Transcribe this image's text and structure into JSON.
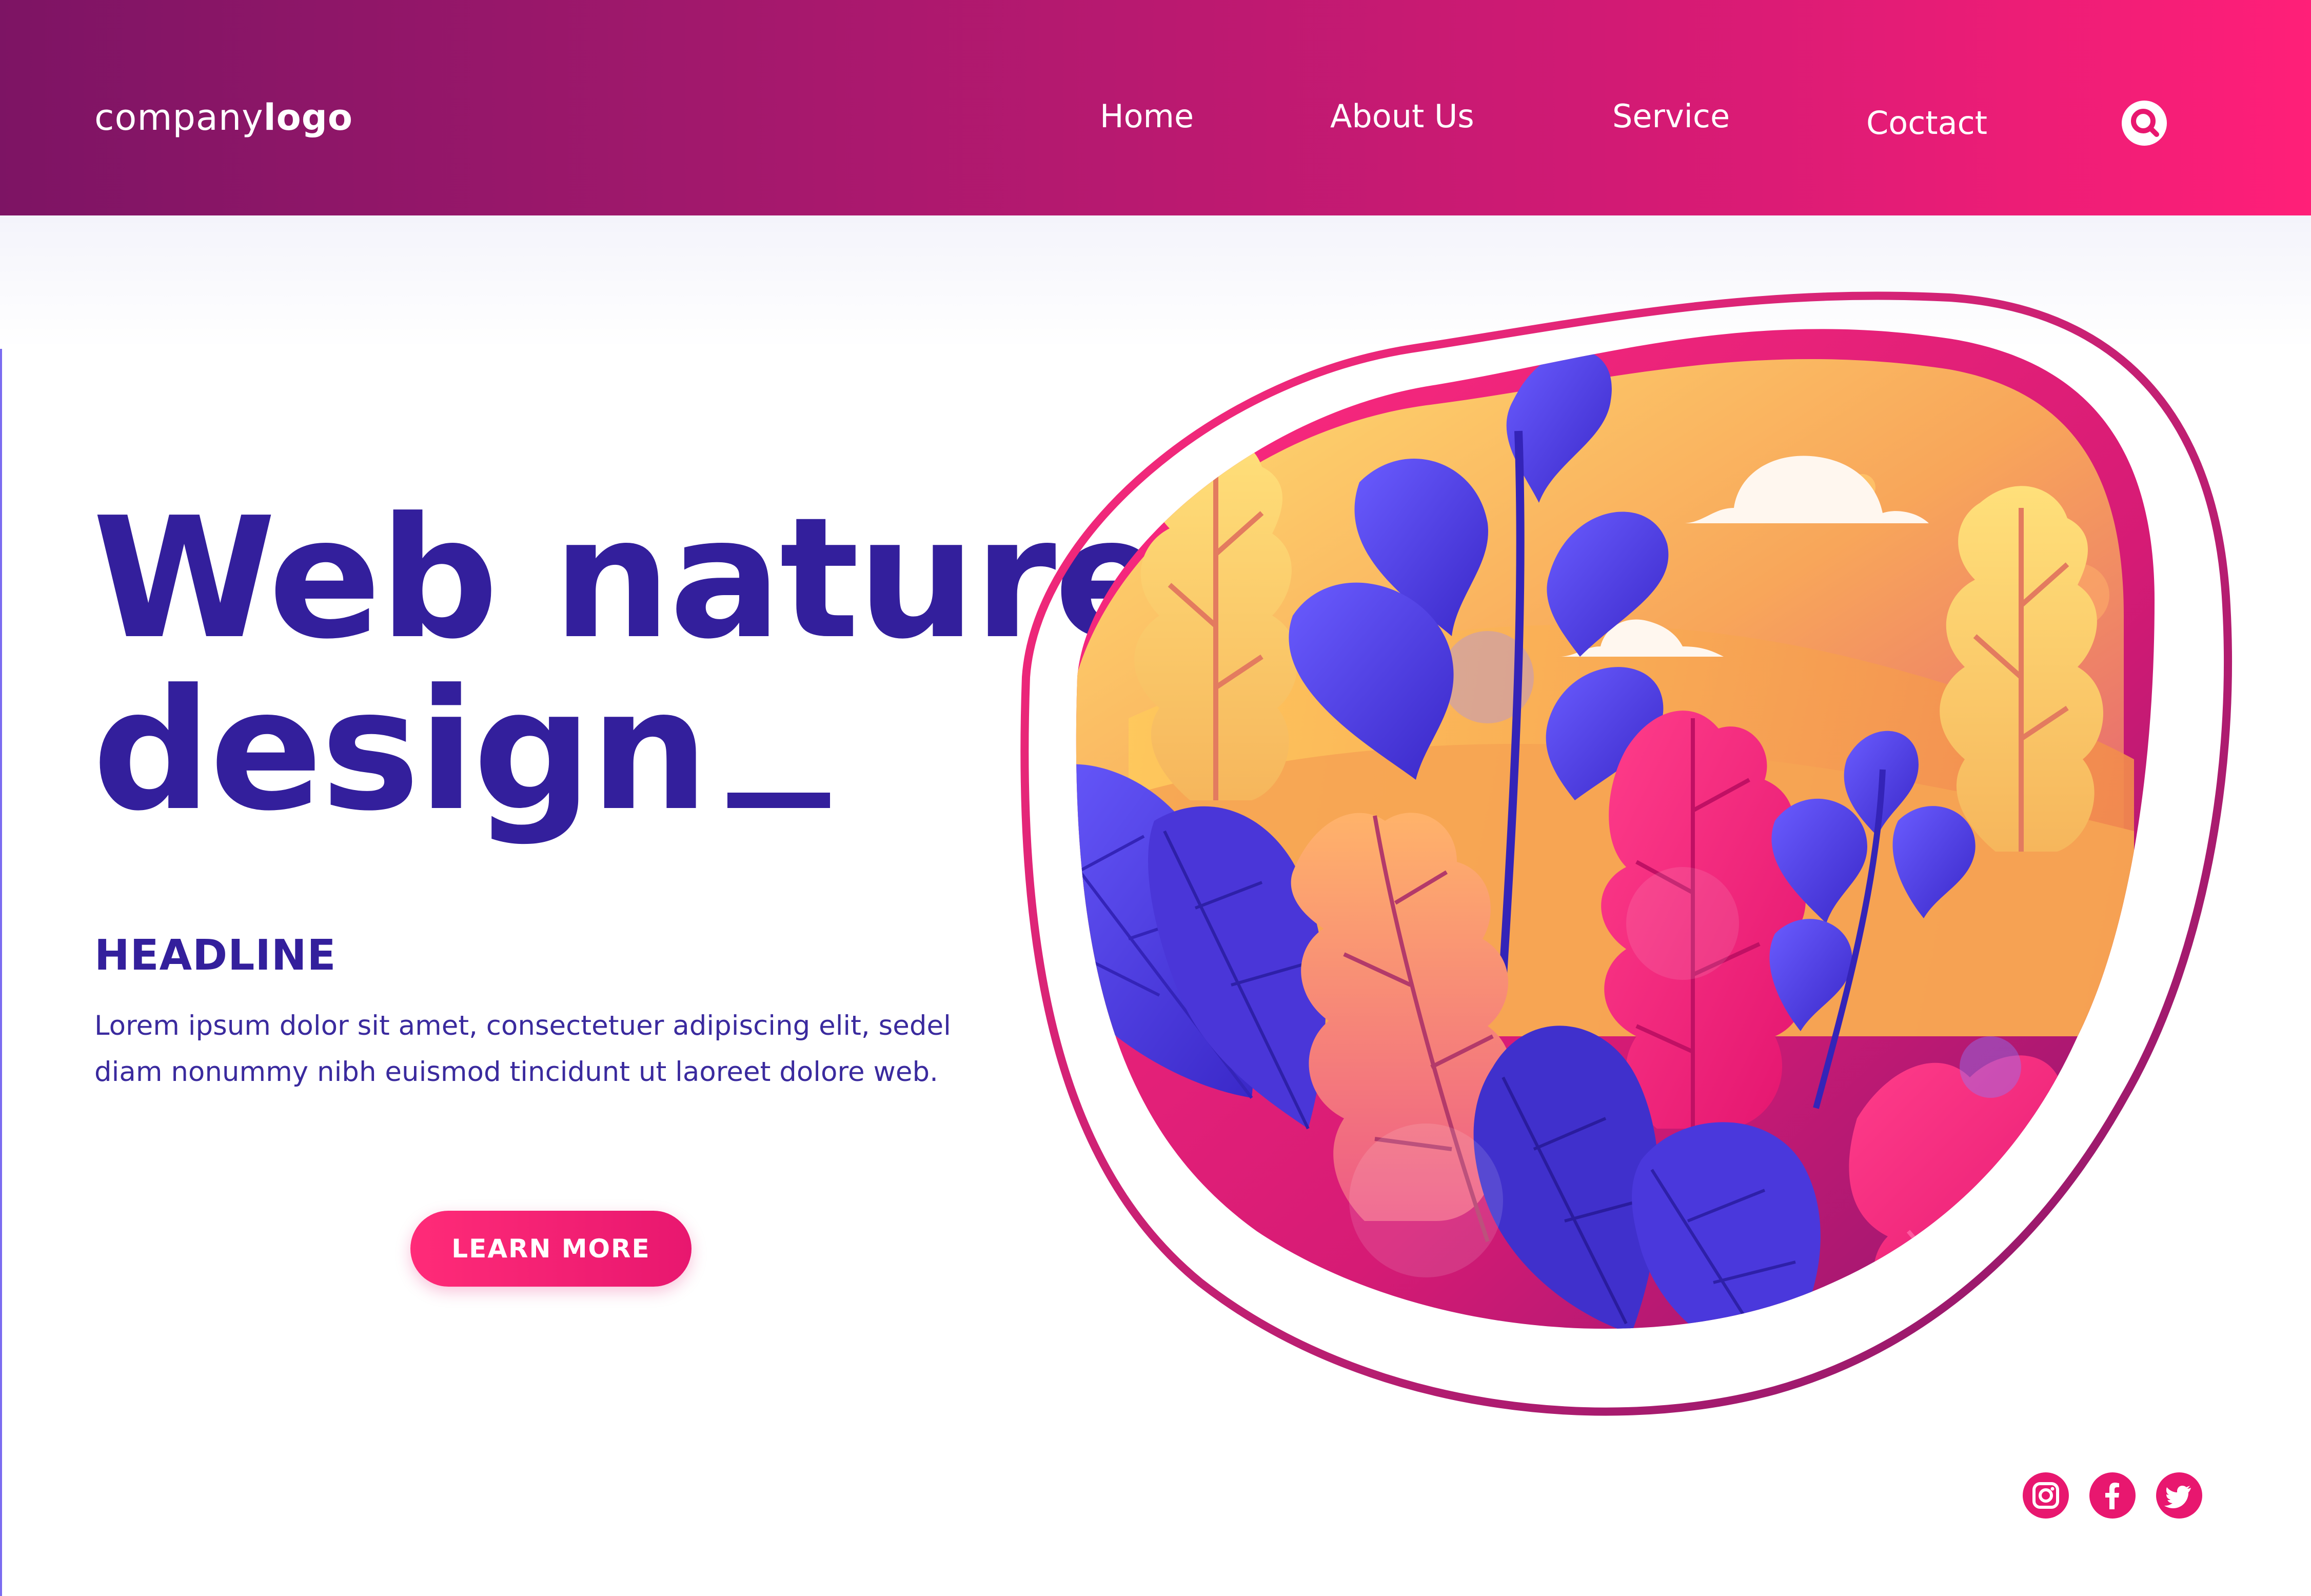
{
  "colors": {
    "navbar_start": "#7d1464",
    "navbar_end": "#ff1f78",
    "heading": "#331f9c",
    "accent_pink": "#e8176f",
    "leaf_purple": "#4b3be0",
    "leaf_yellow": "#ffd86a",
    "leaf_orange": "#f59a5c"
  },
  "header": {
    "logo_regular": "company",
    "logo_bold": "logo",
    "nav": [
      {
        "label": "Home"
      },
      {
        "label": "About Us"
      },
      {
        "label": "Service"
      },
      {
        "label": "Coctact"
      }
    ],
    "search_icon": "search-icon"
  },
  "hero": {
    "title_line1": "Web nature",
    "title_line2": "design",
    "headline": "HEADLINE",
    "body_line1": "Lorem ipsum dolor sit amet, consectetuer adipiscing elit, sedel",
    "body_line2": "diam nonummy nibh euismod tincidunt ut laoreet dolore web.",
    "cta_label": "LEARN MORE"
  },
  "illustration": {
    "subject": "plants-and-leaves-in-blob",
    "icons": [
      "cloud-icon",
      "cloud-icon",
      "leaf-icon"
    ]
  },
  "social": [
    {
      "name": "instagram-icon"
    },
    {
      "name": "facebook-icon"
    },
    {
      "name": "twitter-icon"
    }
  ]
}
